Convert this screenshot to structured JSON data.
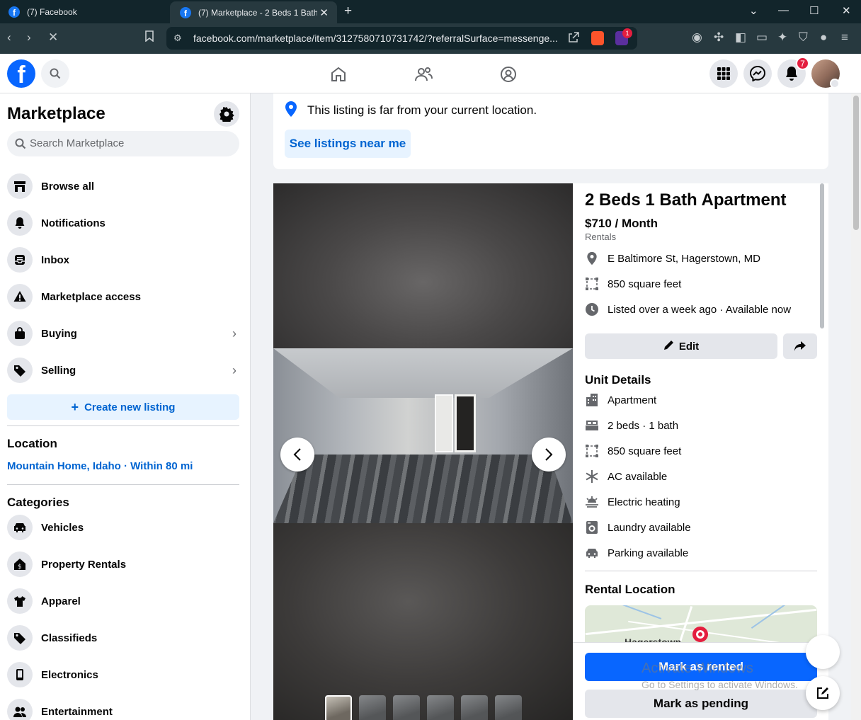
{
  "browser": {
    "tabs": [
      {
        "label": "(7) Facebook"
      },
      {
        "label": "(7) Marketplace - 2 Beds 1 Bath Apartment"
      }
    ],
    "url": "facebook.com/marketplace/item/3127580710731742/?referralSurface=messenge...",
    "brave_badge_count": "1"
  },
  "header": {
    "notifications_count": "7"
  },
  "sidebar": {
    "title": "Marketplace",
    "search_placeholder": "Search Marketplace",
    "items": [
      {
        "label": "Browse all",
        "icon": "storefront-icon"
      },
      {
        "label": "Notifications",
        "icon": "bell-icon"
      },
      {
        "label": "Inbox",
        "icon": "inbox-icon"
      },
      {
        "label": "Marketplace access",
        "icon": "warning-icon"
      },
      {
        "label": "Buying",
        "icon": "shopping-bag-icon"
      },
      {
        "label": "Selling",
        "icon": "price-tag-icon"
      }
    ],
    "create_label": "Create new listing",
    "location_heading": "Location",
    "location_value": "Mountain Home, Idaho · Within 80 mi",
    "categories_heading": "Categories",
    "categories": [
      {
        "label": "Vehicles",
        "icon": "car-icon"
      },
      {
        "label": "Property Rentals",
        "icon": "house-dollar-icon"
      },
      {
        "label": "Apparel",
        "icon": "shirt-icon"
      },
      {
        "label": "Classifieds",
        "icon": "tag-icon"
      },
      {
        "label": "Electronics",
        "icon": "phone-icon"
      },
      {
        "label": "Entertainment",
        "icon": "people-icon"
      }
    ]
  },
  "notice": {
    "message": "This listing is far from your current location.",
    "button": "See listings near me"
  },
  "listing": {
    "title": "2 Beds 1 Bath Apartment",
    "price": "$710 / Month",
    "category": "Rentals",
    "address": "E Baltimore St, Hagerstown, MD",
    "size": "850 square feet",
    "listed": "Listed over a week ago · Available now",
    "edit_label": "Edit",
    "unit_details_heading": "Unit Details",
    "unit_details": [
      {
        "label": "Apartment",
        "icon": "building-icon"
      },
      {
        "label": "2 beds · 1 bath",
        "icon": "bed-icon"
      },
      {
        "label": "850 square feet",
        "icon": "square-footage-icon"
      },
      {
        "label": "AC available",
        "icon": "snowflake-icon"
      },
      {
        "label": "Electric heating",
        "icon": "heating-icon"
      },
      {
        "label": "Laundry available",
        "icon": "washer-icon"
      },
      {
        "label": "Parking available",
        "icon": "car-icon"
      }
    ],
    "rental_location_heading": "Rental Location",
    "map_label": "Hagerstown",
    "mark_rented": "Mark as rented",
    "mark_pending": "Mark as pending"
  },
  "watermark": {
    "line1": "Activate Windows",
    "line2": "Go to Settings to activate Windows."
  }
}
